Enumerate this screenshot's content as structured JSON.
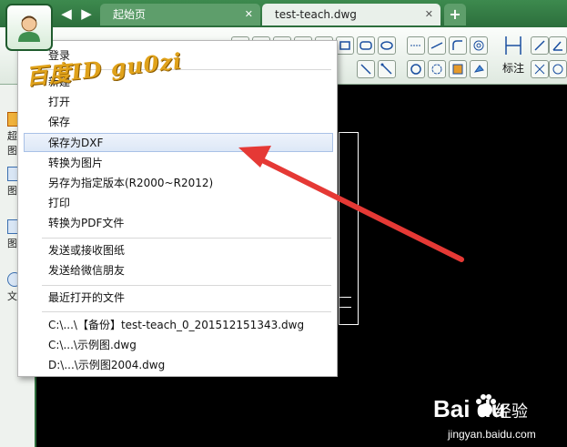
{
  "tabs": {
    "home_label": "起始页",
    "doc_label": "test-teach.dwg",
    "close_glyph": "✕",
    "add_glyph": "+"
  },
  "ribbon": {
    "dimension_label": "标注"
  },
  "left_panel": {
    "items": [
      "超\n图",
      "图",
      "图",
      "文"
    ]
  },
  "menu": {
    "items": [
      {
        "label": "登录"
      },
      {
        "label": "新建"
      },
      {
        "label": "打开"
      },
      {
        "label": "保存"
      },
      {
        "label": "保存为DXF",
        "highlighted": true
      },
      {
        "label": "转换为图片"
      },
      {
        "label": "另存为指定版本(R2000~R2012)"
      },
      {
        "label": "打印"
      },
      {
        "label": "转换为PDF文件"
      },
      {
        "label": "发送或接收图纸"
      },
      {
        "label": "发送给微信朋友"
      },
      {
        "label": "最近打开的文件"
      },
      {
        "label": "C:\\...\\【备份】test-teach_0_201512151343.dwg"
      },
      {
        "label": "C:\\...\\示例图.dwg"
      },
      {
        "label": "D:\\...\\示例图2004.dwg"
      }
    ]
  },
  "watermark": {
    "text": "百度ID  gu0zi"
  },
  "branding": {
    "logo": "Bai du",
    "sub": "经验",
    "url": "jingyan.baidu.com"
  },
  "colors": {
    "accent_green": "#2c6e3c",
    "arrow_red": "#e53935",
    "highlight_blue": "#dde8f7"
  }
}
